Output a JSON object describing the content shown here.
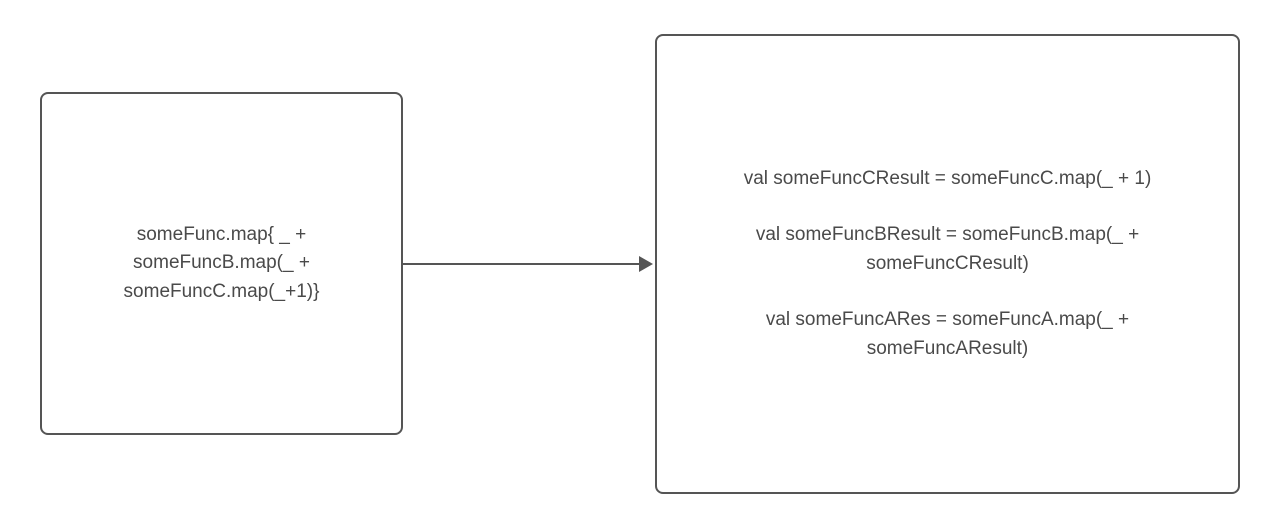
{
  "leftBox": {
    "line1": "someFunc.map{ _ +",
    "line2": "someFuncB.map(_ +",
    "line3": "someFuncC.map(_+1)}"
  },
  "rightBox": {
    "group1": {
      "line1": "val someFuncCResult = someFuncC.map(_ + 1)"
    },
    "group2": {
      "line1": "val someFuncBResult = someFuncB.map(_ +",
      "line2": "someFuncCResult)"
    },
    "group3": {
      "line1": "val someFuncARes = someFuncA.map(_ +",
      "line2": "someFuncAResult)"
    }
  }
}
